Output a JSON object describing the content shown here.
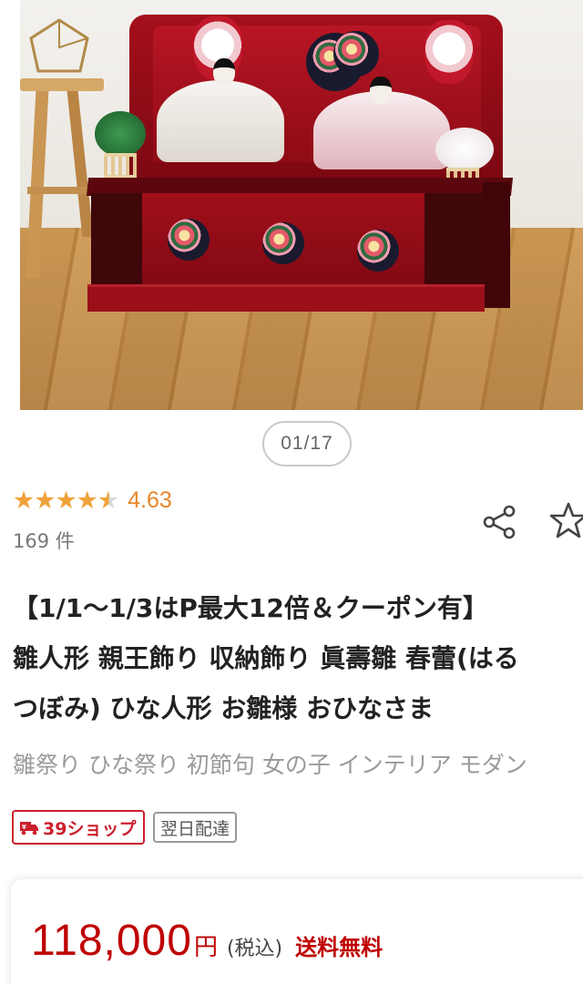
{
  "gallery": {
    "counter": "01/17"
  },
  "rating": {
    "value": "4.63",
    "stars": 4.63,
    "review_count": "169 件"
  },
  "product": {
    "title_lines": [
      "【1/1〜1/3はP最大12倍＆クーポン有】",
      "雛人形 親王飾り 収納飾り 眞壽雛 春蕾(はる",
      "つぼみ) ひな人形 お雛様 おひなさま"
    ],
    "subtitle": "雛祭り ひな祭り 初節句 女の子 インテリア モダン"
  },
  "badges": {
    "shop": "39ショップ",
    "delivery": "翌日配達"
  },
  "price": {
    "amount": "118,000",
    "currency": "円",
    "tax": "(税込)",
    "shipping": "送料無料"
  },
  "icons": {
    "share": "share-icon",
    "favorite": "star-outline-icon",
    "truck": "truck-icon"
  },
  "colors": {
    "accent_red": "#bf0000",
    "star_orange": "#f0a23a",
    "rating_text": "#e8862a"
  }
}
